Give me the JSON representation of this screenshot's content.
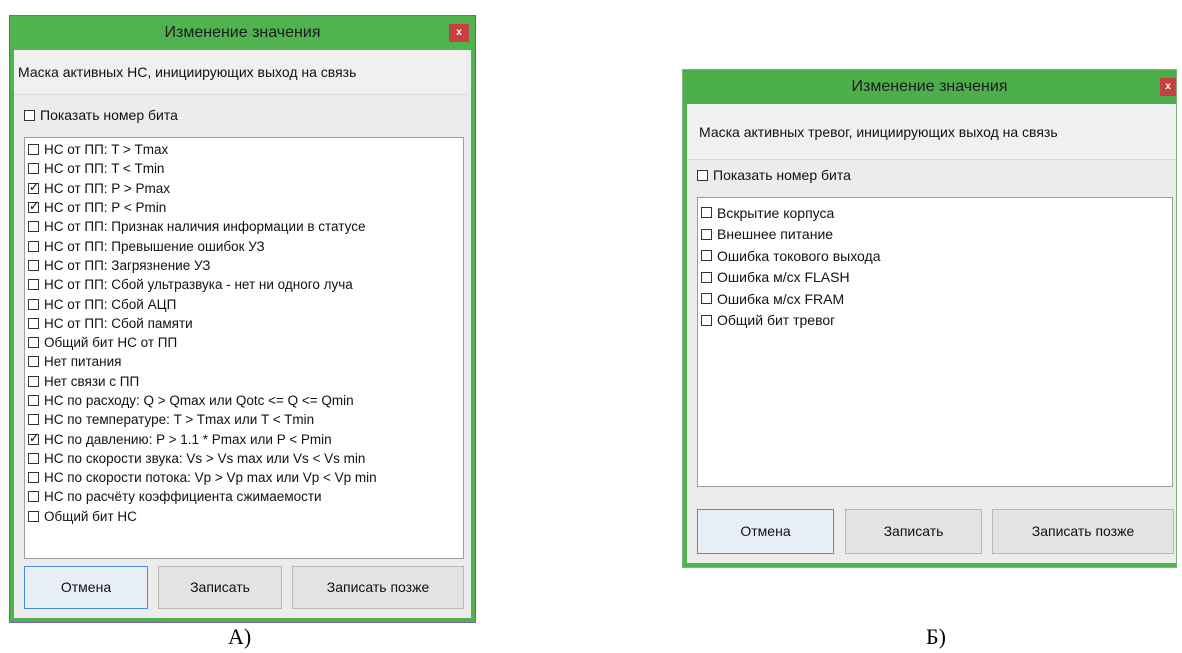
{
  "dialog_a": {
    "title": "Изменение значения",
    "close_label": "x",
    "header": "Маска активных НС, инициирующих выход на связь",
    "show_bit_label": "Показать номер бита",
    "show_bit_checked": false,
    "items": [
      {
        "label": "НС от ПП: T > Tmax",
        "checked": false
      },
      {
        "label": "НС от ПП: T < Tmin",
        "checked": false
      },
      {
        "label": "НС от ПП: P > Pmax",
        "checked": true
      },
      {
        "label": "НС от ПП: P < Pmin",
        "checked": true
      },
      {
        "label": "НС от ПП: Признак наличия информации в статусе",
        "checked": false
      },
      {
        "label": "НС от ПП: Превышение ошибок УЗ",
        "checked": false
      },
      {
        "label": "НС от ПП: Загрязнение УЗ",
        "checked": false
      },
      {
        "label": "НС от ПП: Сбой ультразвука - нет ни одного луча",
        "checked": false
      },
      {
        "label": "НС от ПП: Сбой АЦП",
        "checked": false
      },
      {
        "label": "НС от ПП: Сбой памяти",
        "checked": false
      },
      {
        "label": "Общий бит НС от ПП",
        "checked": false
      },
      {
        "label": "Нет питания",
        "checked": false
      },
      {
        "label": "Нет связи с ПП",
        "checked": false
      },
      {
        "label": "НС по расходу: Q > Qmax или Qotc <= Q <= Qmin",
        "checked": false
      },
      {
        "label": "НС по температуре: T > Tmax или T < Tmin",
        "checked": false
      },
      {
        "label": "НС по давлению: P > 1.1 * Pmax или P < Pmin",
        "checked": true
      },
      {
        "label": "НС по скорости звука: Vs > Vs max или Vs < Vs min",
        "checked": false
      },
      {
        "label": "НС по скорости потока: Vp > Vp max или Vp < Vp min",
        "checked": false
      },
      {
        "label": "НС по расчёту коэффициента сжимаемости",
        "checked": false
      },
      {
        "label": "Общий бит НС",
        "checked": false
      }
    ],
    "buttons": {
      "cancel": "Отмена",
      "write": "Записать",
      "write_later": "Записать позже"
    }
  },
  "dialog_b": {
    "title": "Изменение значения",
    "close_label": "x",
    "header": "Маска активных тревог, инициирующих выход на связь",
    "show_bit_label": "Показать номер бита",
    "show_bit_checked": false,
    "items": [
      {
        "label": "Вскрытие корпуса",
        "checked": false
      },
      {
        "label": "Внешнее питание",
        "checked": false
      },
      {
        "label": "Ошибка токового выхода",
        "checked": false
      },
      {
        "label": "Ошибка м/сх FLASH",
        "checked": false
      },
      {
        "label": "Ошибка м/сх FRAM",
        "checked": false
      },
      {
        "label": "Общий бит тревог",
        "checked": false
      }
    ],
    "buttons": {
      "cancel": "Отмена",
      "write": "Записать",
      "write_later": "Записать позже"
    }
  },
  "captions": {
    "a": "А)",
    "b": "Б)"
  },
  "colors": {
    "title_bar": "#50b350",
    "close_button": "#c94040",
    "primary_border": "#4a90d9"
  }
}
